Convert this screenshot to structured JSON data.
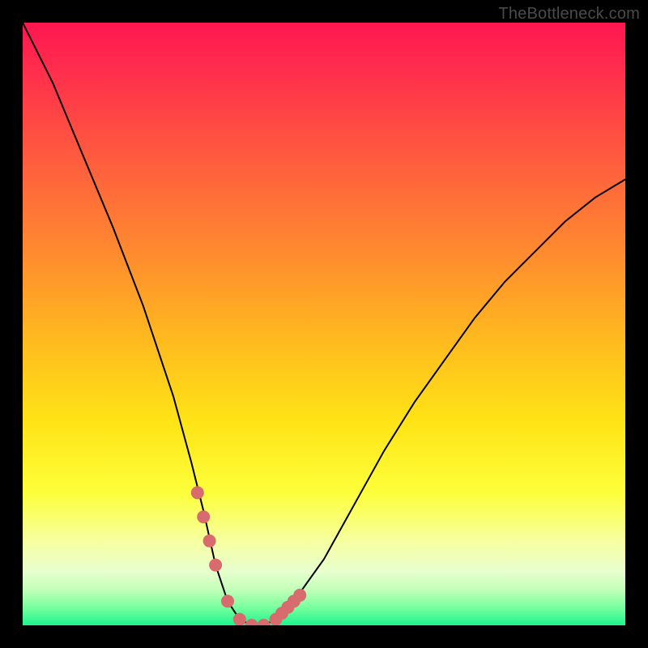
{
  "watermark": "TheBottleneck.com",
  "chart_data": {
    "type": "line",
    "title": "",
    "xlabel": "",
    "ylabel": "",
    "xlim": [
      0,
      100
    ],
    "ylim": [
      0,
      100
    ],
    "series": [
      {
        "name": "bottleneck-curve",
        "x": [
          0,
          5,
          10,
          15,
          20,
          25,
          28,
          30,
          32,
          34,
          36,
          38,
          40,
          42,
          45,
          50,
          55,
          60,
          65,
          70,
          75,
          80,
          85,
          90,
          95,
          100
        ],
        "values": [
          100,
          90,
          78,
          66,
          53,
          38,
          27,
          19,
          10,
          4,
          1,
          0,
          0,
          1,
          4,
          11,
          20,
          29,
          37,
          44,
          51,
          57,
          62,
          67,
          71,
          74
        ]
      },
      {
        "name": "highlight-dots",
        "x": [
          29,
          30,
          31,
          32,
          34,
          36,
          38,
          40,
          42,
          43,
          44,
          45,
          46
        ],
        "values": [
          22,
          18,
          14,
          10,
          4,
          1,
          0,
          0,
          1,
          2,
          3,
          4,
          5
        ]
      }
    ],
    "colors": {
      "curve": "#000000",
      "dots": "#d86b6e"
    }
  }
}
